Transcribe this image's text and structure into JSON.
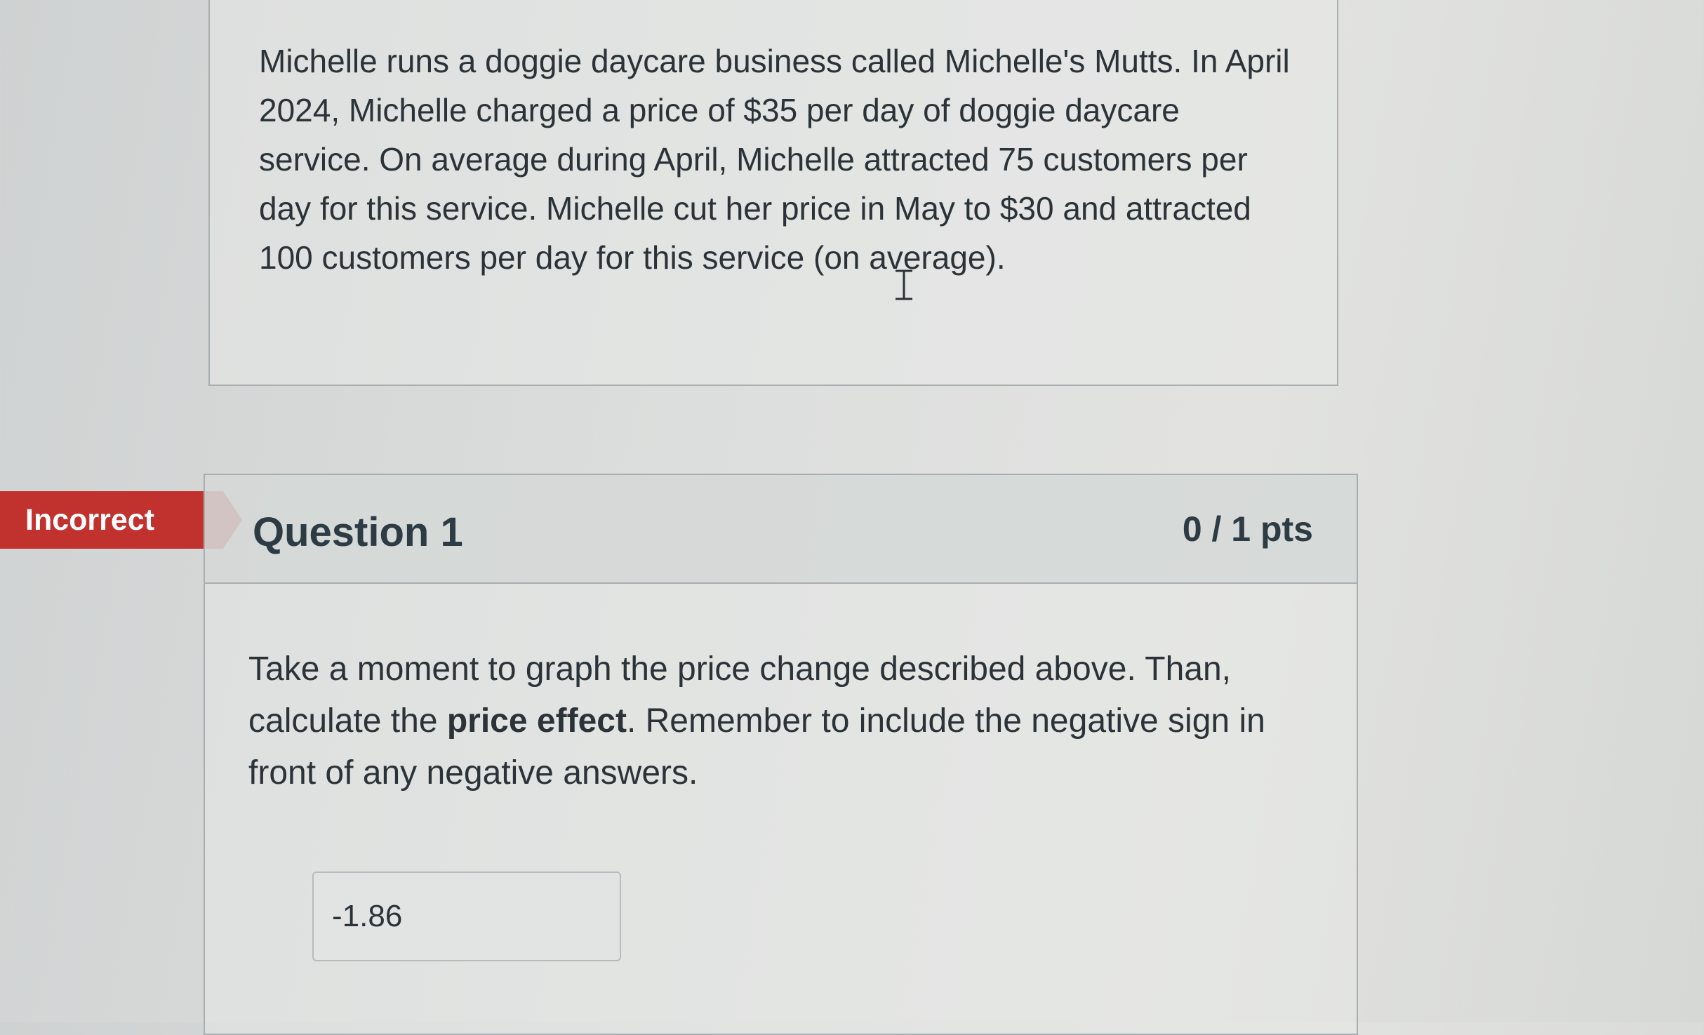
{
  "context": {
    "paragraph": "Michelle runs a doggie daycare business called Michelle's Mutts. In April 2024, Michelle charged a price of $35 per day of doggie daycare service. On average during April, Michelle attracted 75 customers per day for this service. Michelle cut her price in May to $30 and attracted 100 customers per day for this service (on average)."
  },
  "status_flag": {
    "label": "Incorrect",
    "color": "#c1322f"
  },
  "question": {
    "title": "Question 1",
    "points": "0 / 1 pts",
    "text_before": "Take a moment to graph the price change described above. Than, calculate the ",
    "text_bold": "price effect",
    "text_after": ". Remember to include the negative sign in front of any negative answers.",
    "answer_value": "-1.86"
  },
  "icons": {
    "cursor": "text-cursor-icon"
  }
}
